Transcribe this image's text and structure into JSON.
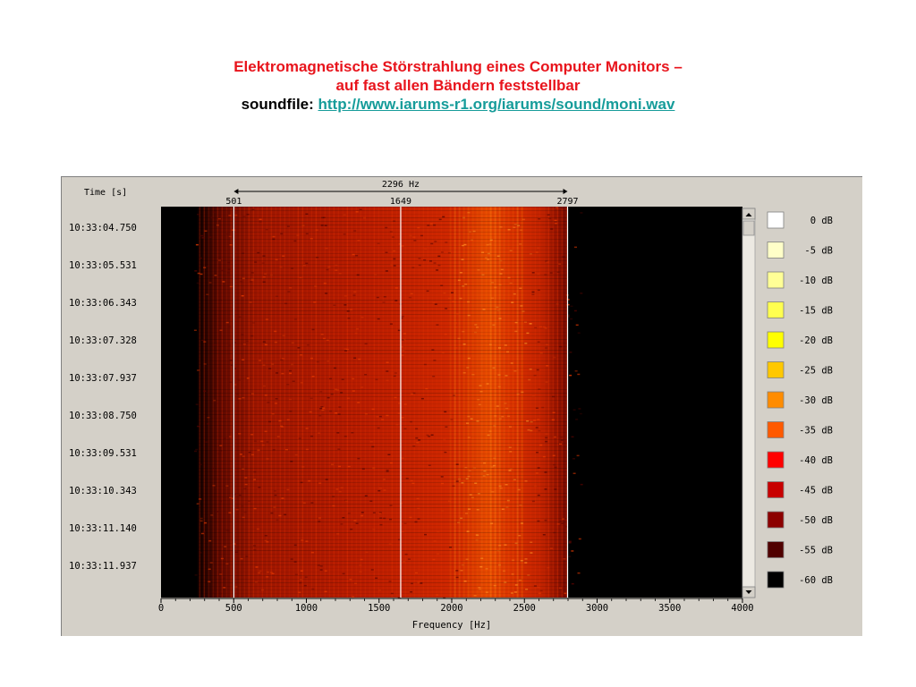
{
  "header": {
    "title_line1": "Elektromagnetische Störstrahlung eines Computer Monitors –",
    "title_line2": "auf fast allen Bändern feststellbar",
    "soundfile_label": "soundfile:",
    "soundfile_link": "http://www.iarums-r1.org/iarums/sound/moni.wav"
  },
  "chart_data": {
    "type": "heatmap",
    "title": "",
    "xlabel": "Frequency [Hz]",
    "ylabel": "Time [s]",
    "xlim": [
      0,
      4000
    ],
    "x_ticks": [
      0,
      500,
      1000,
      1500,
      2000,
      2500,
      3000,
      3500,
      4000
    ],
    "y_ticks": [
      "10:33:04.750",
      "10:33:05.531",
      "10:33:06.343",
      "10:33:07.328",
      "10:33:07.937",
      "10:33:08.750",
      "10:33:09.531",
      "10:33:10.343",
      "10:33:11.140",
      "10:33:11.937"
    ],
    "markers": {
      "span_label": "2296 Hz",
      "values": [
        501,
        1649,
        2797
      ],
      "labels": [
        "501",
        "1649",
        "2797"
      ]
    },
    "signal_band_hz": [
      250,
      2800
    ],
    "legend": [
      {
        "label": "0 dB",
        "color": "#ffffff"
      },
      {
        "label": "-5 dB",
        "color": "#ffffc8"
      },
      {
        "label": "-10 dB",
        "color": "#ffff96"
      },
      {
        "label": "-15 dB",
        "color": "#ffff50"
      },
      {
        "label": "-20 dB",
        "color": "#ffff00"
      },
      {
        "label": "-25 dB",
        "color": "#ffc800"
      },
      {
        "label": "-30 dB",
        "color": "#ff8c00"
      },
      {
        "label": "-35 dB",
        "color": "#ff5a00"
      },
      {
        "label": "-40 dB",
        "color": "#ff0000"
      },
      {
        "label": "-45 dB",
        "color": "#c80000"
      },
      {
        "label": "-50 dB",
        "color": "#8c0000"
      },
      {
        "label": "-55 dB",
        "color": "#500000"
      },
      {
        "label": "-60 dB",
        "color": "#000000"
      }
    ],
    "legend_position": "right",
    "grid": false
  }
}
